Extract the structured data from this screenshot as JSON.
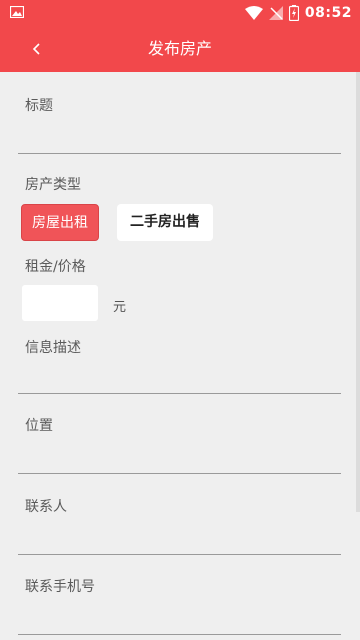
{
  "statusbar": {
    "time": "08:52"
  },
  "appbar": {
    "title": "发布房产",
    "back_icon": "chevron-left-icon"
  },
  "form": {
    "title_label": "标题",
    "type_label": "房产类型",
    "types": [
      {
        "label": "房屋出租",
        "selected": true
      },
      {
        "label": "二手房出售",
        "selected": false
      }
    ],
    "price_label": "租金/价格",
    "price_value": "",
    "price_unit": "元",
    "desc_label": "信息描述",
    "location_label": "位置",
    "contact_label": "联系人",
    "phone_label": "联系手机号"
  },
  "colors": {
    "primary": "#f2484b",
    "selected_button": "#f05458",
    "background": "#efefef"
  }
}
